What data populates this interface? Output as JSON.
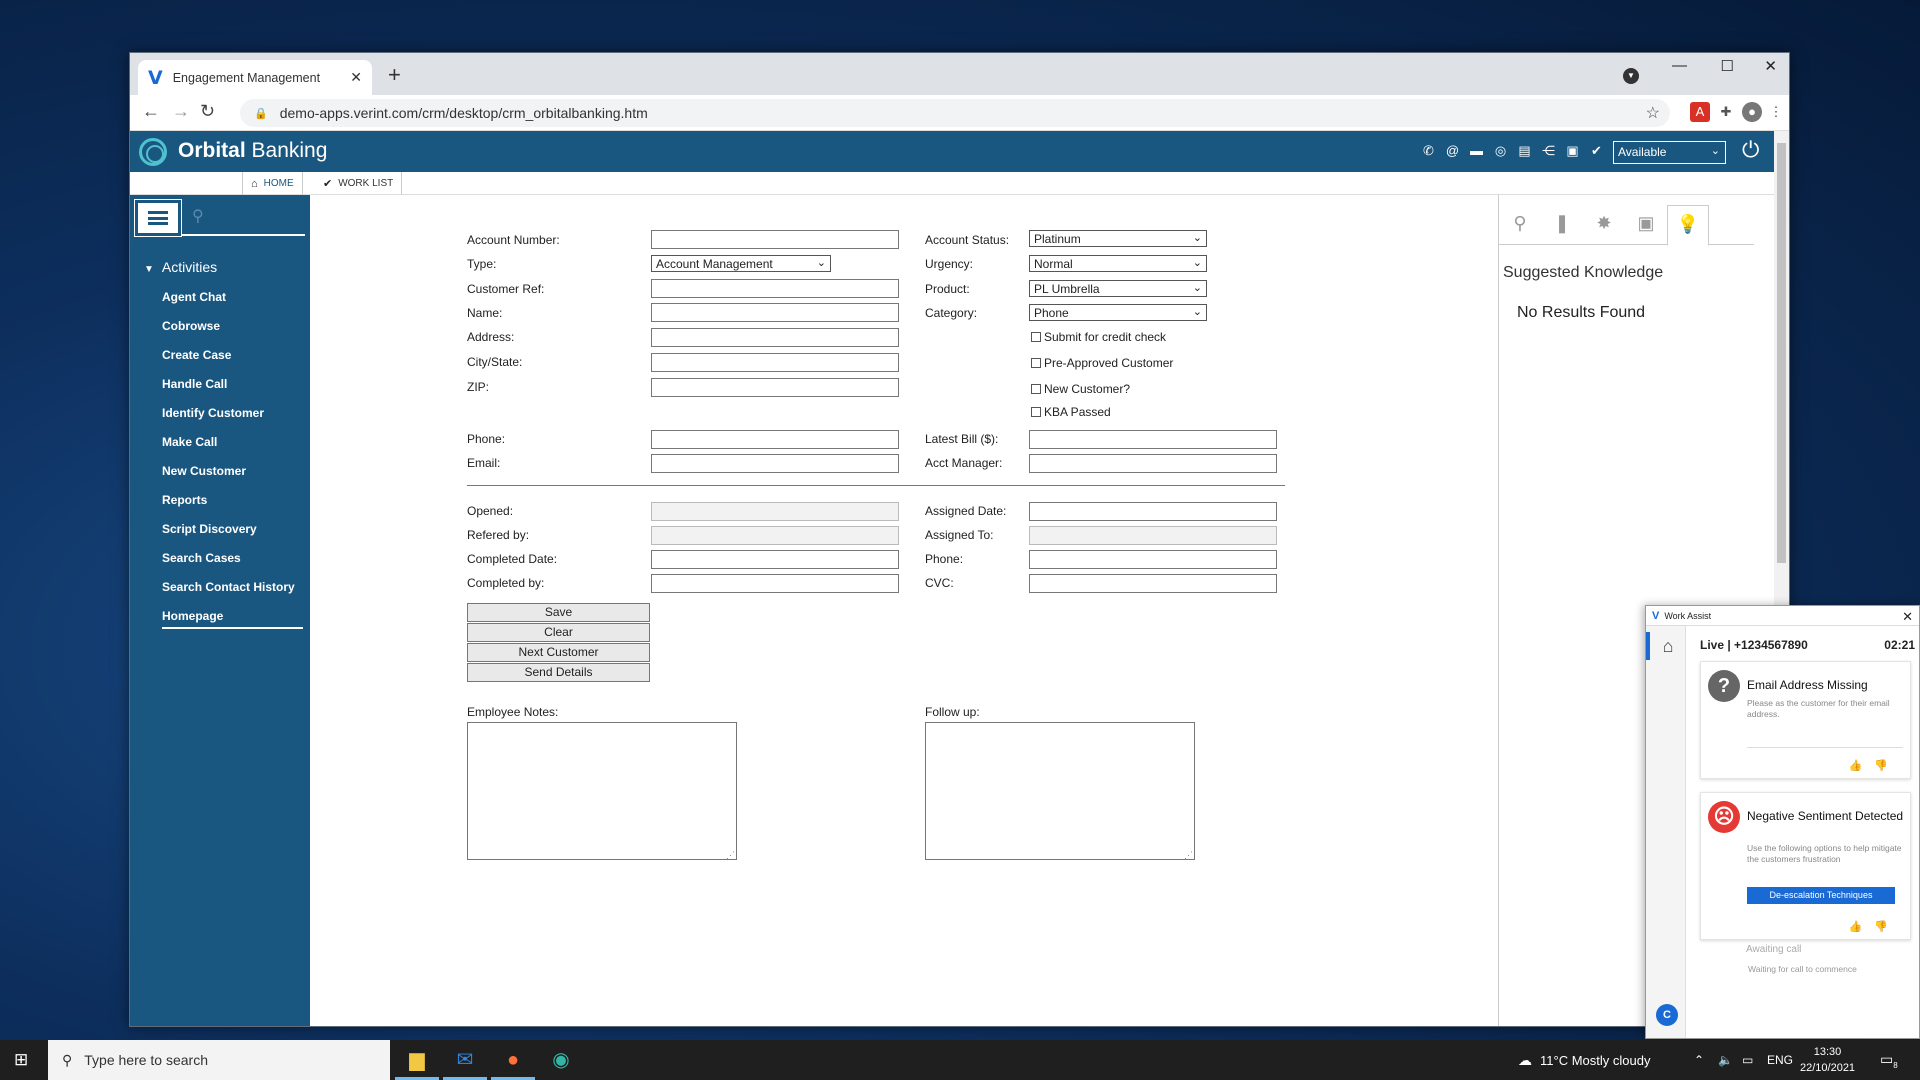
{
  "browser": {
    "tab_title": "Engagement Management",
    "url": "demo-apps.verint.com/crm/desktop/crm_orbitalbanking.htm"
  },
  "app": {
    "brand_bold": "Orbital",
    "brand_rest": " Banking",
    "status": "Available",
    "tabs": {
      "home": "HOME",
      "work_list": "WORK LIST"
    }
  },
  "sidebar": {
    "section": "Activities",
    "items": [
      "Agent Chat",
      "Cobrowse",
      "Create Case",
      "Handle Call",
      "Identify Customer",
      "Make Call",
      "New Customer",
      "Reports",
      "Script Discovery",
      "Search Cases",
      "Search Contact History",
      "Homepage"
    ]
  },
  "form": {
    "labels": {
      "account_number": "Account Number:",
      "type": "Type:",
      "customer_ref": "Customer Ref:",
      "name": "Name:",
      "address": "Address:",
      "city_state": "City/State:",
      "zip": "ZIP:",
      "phone": "Phone:",
      "email": "Email:",
      "account_status": "Account Status:",
      "urgency": "Urgency:",
      "product": "Product:",
      "category": "Category:",
      "latest_bill": "Latest Bill ($):",
      "acct_manager": "Acct Manager:",
      "opened": "Opened:",
      "refered_by": "Refered by:",
      "completed_date": "Completed Date:",
      "completed_by": "Completed by:",
      "assigned_date": "Assigned Date:",
      "assigned_to": "Assigned To:",
      "phone2": "Phone:",
      "cvc": "CVC:",
      "employee_notes": "Employee Notes:",
      "follow_up": "Follow up:"
    },
    "selects": {
      "type": "Account Management",
      "account_status": "Platinum",
      "urgency": "Normal",
      "product": "PL Umbrella",
      "category": "Phone"
    },
    "checkboxes": {
      "credit_check": "Submit for credit check",
      "pre_approved": "Pre-Approved Customer",
      "new_customer": "New Customer?",
      "kba_passed": "KBA Passed"
    },
    "buttons": {
      "save": "Save",
      "clear": "Clear",
      "next_customer": "Next Customer",
      "send_details": "Send Details"
    }
  },
  "right_panel": {
    "title": "Suggested Knowledge",
    "empty": "No Results Found"
  },
  "work_assist": {
    "title": "Work Assist",
    "live": "Live | +1234567890",
    "timer": "02:21",
    "card1_title": "Email Address Missing",
    "card1_desc": "Please as the customer for their email address.",
    "card2_title": "Negative Sentiment Detected",
    "card2_desc": "Use the following options to help mitigate the customers frustration",
    "card2_button": "De-escalation Techniques",
    "awaiting": "Awaiting call",
    "waiting": "Waiting for call to commence",
    "avatar": "C"
  },
  "taskbar": {
    "search_placeholder": "Type here to search",
    "weather": "11°C  Mostly cloudy",
    "lang": "ENG",
    "time": "13:30",
    "date": "22/10/2021",
    "notifications": "8"
  }
}
